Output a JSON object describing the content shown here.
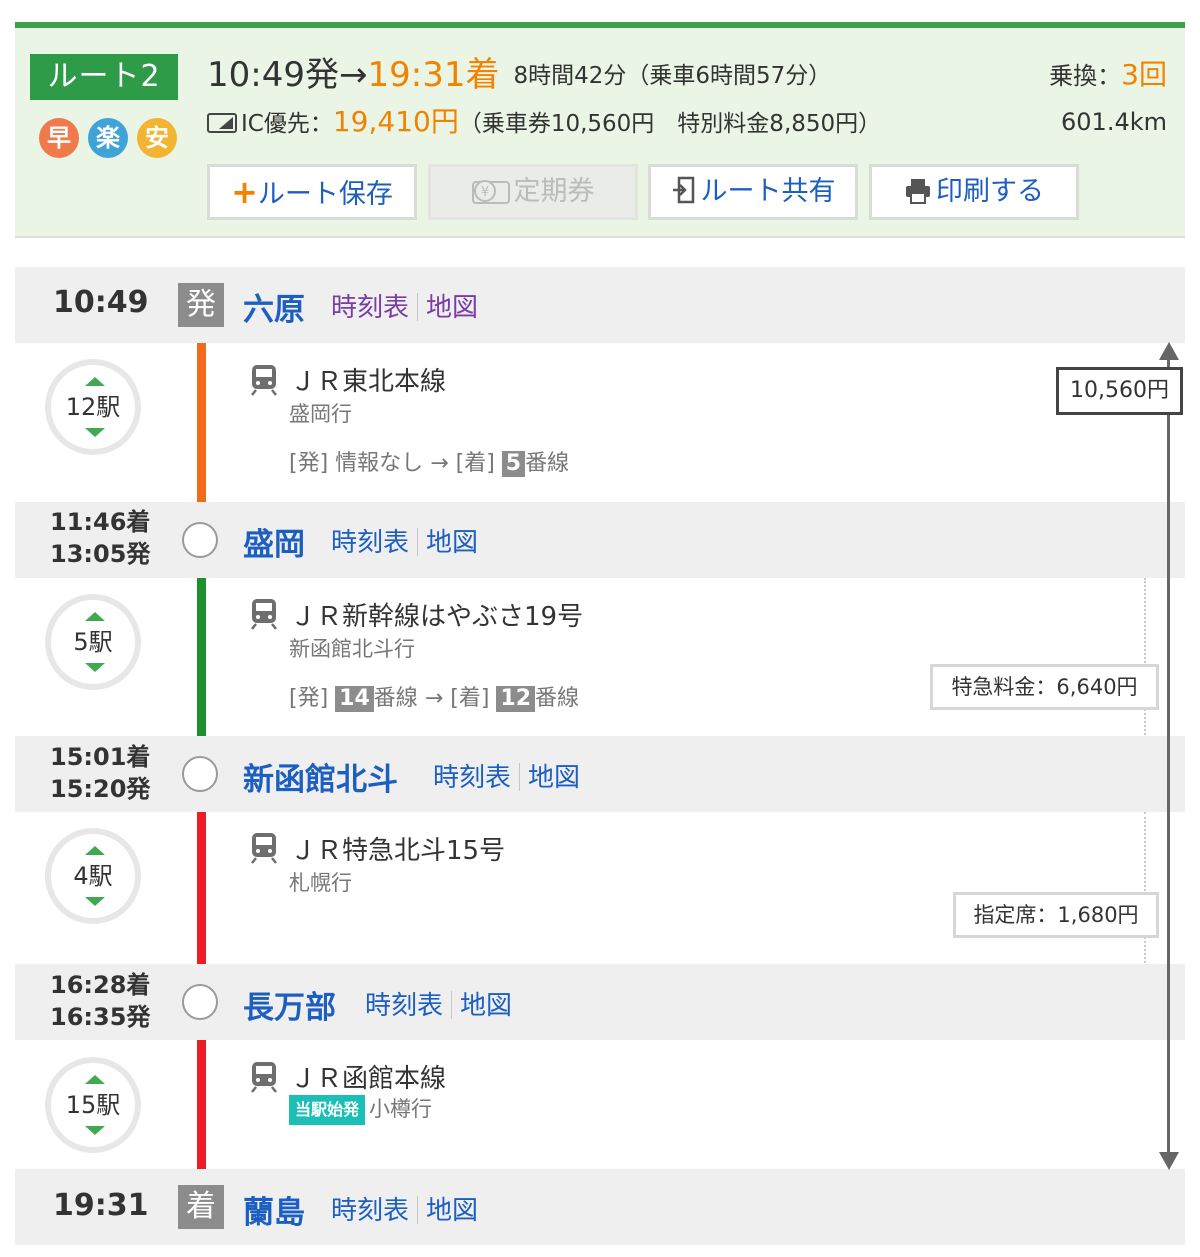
{
  "summary": {
    "route_label": "ルート2",
    "badges": [
      {
        "label": "早",
        "color": "#f07a4c"
      },
      {
        "label": "楽",
        "color": "#3fa3d8"
      },
      {
        "label": "安",
        "color": "#f2b531"
      }
    ],
    "departure": "10:49発",
    "arrow": "→",
    "arrival": "19:31着",
    "duration": "8時間42分（乗車6時間57分）",
    "ic_label": "IC優先：",
    "total_fare": "19,410円",
    "fare_breakdown": "（乗車券10,560円　特別料金8,850円）",
    "transfer_label": "乗換：",
    "transfer_count": "3回",
    "distance": "601.4km"
  },
  "actions": {
    "save": {
      "plus": "+",
      "label": "ルート保存"
    },
    "commuter_pass": {
      "label": "定期券"
    },
    "share": {
      "label": "ルート共有"
    },
    "print": {
      "label": "印刷する"
    }
  },
  "link_labels": {
    "timetable": "時刻表",
    "map": "地図"
  },
  "markers": {
    "depart": "発",
    "arrive": "着"
  },
  "stations": [
    {
      "name": "六原",
      "time": "10:49"
    },
    {
      "name": "盛岡",
      "arr_time": "11:46着",
      "dep_time": "13:05発"
    },
    {
      "name": "新函館北斗",
      "arr_time": "15:01着",
      "dep_time": "15:20発"
    },
    {
      "name": "長万部",
      "arr_time": "16:28着",
      "dep_time": "16:35発"
    },
    {
      "name": "蘭島",
      "time": "19:31"
    }
  ],
  "segments": [
    {
      "stops": "12駅",
      "line_color": "#f26a1b",
      "line": "ＪＲ東北本線",
      "destination": "盛岡行",
      "platform": {
        "dep_label": "[発]",
        "dep_value": "情報なし",
        "arrow": "→",
        "arr_label": "[着]",
        "arr_num": "5",
        "suffix": "番線"
      }
    },
    {
      "stops": "5駅",
      "line_color": "#1e8f2d",
      "line": "ＪＲ新幹線はやぶさ19号",
      "destination": "新函館北斗行",
      "platform": {
        "dep_label": "[発]",
        "dep_num": "14",
        "dep_suffix": "番線",
        "arrow": "→",
        "arr_label": "[着]",
        "arr_num": "12",
        "suffix": "番線"
      },
      "fee": "特急料金：6,640円"
    },
    {
      "stops": "4駅",
      "line_color": "#ee1c25",
      "line": "ＪＲ特急北斗15号",
      "destination": "札幌行",
      "fee": "指定席：1,680円"
    },
    {
      "stops": "15駅",
      "line_color": "#ee1c25",
      "line": "ＪＲ函館本線",
      "start_badge": "当駅始発",
      "destination": "小樽行"
    }
  ],
  "fare_total_box": "10,560円"
}
